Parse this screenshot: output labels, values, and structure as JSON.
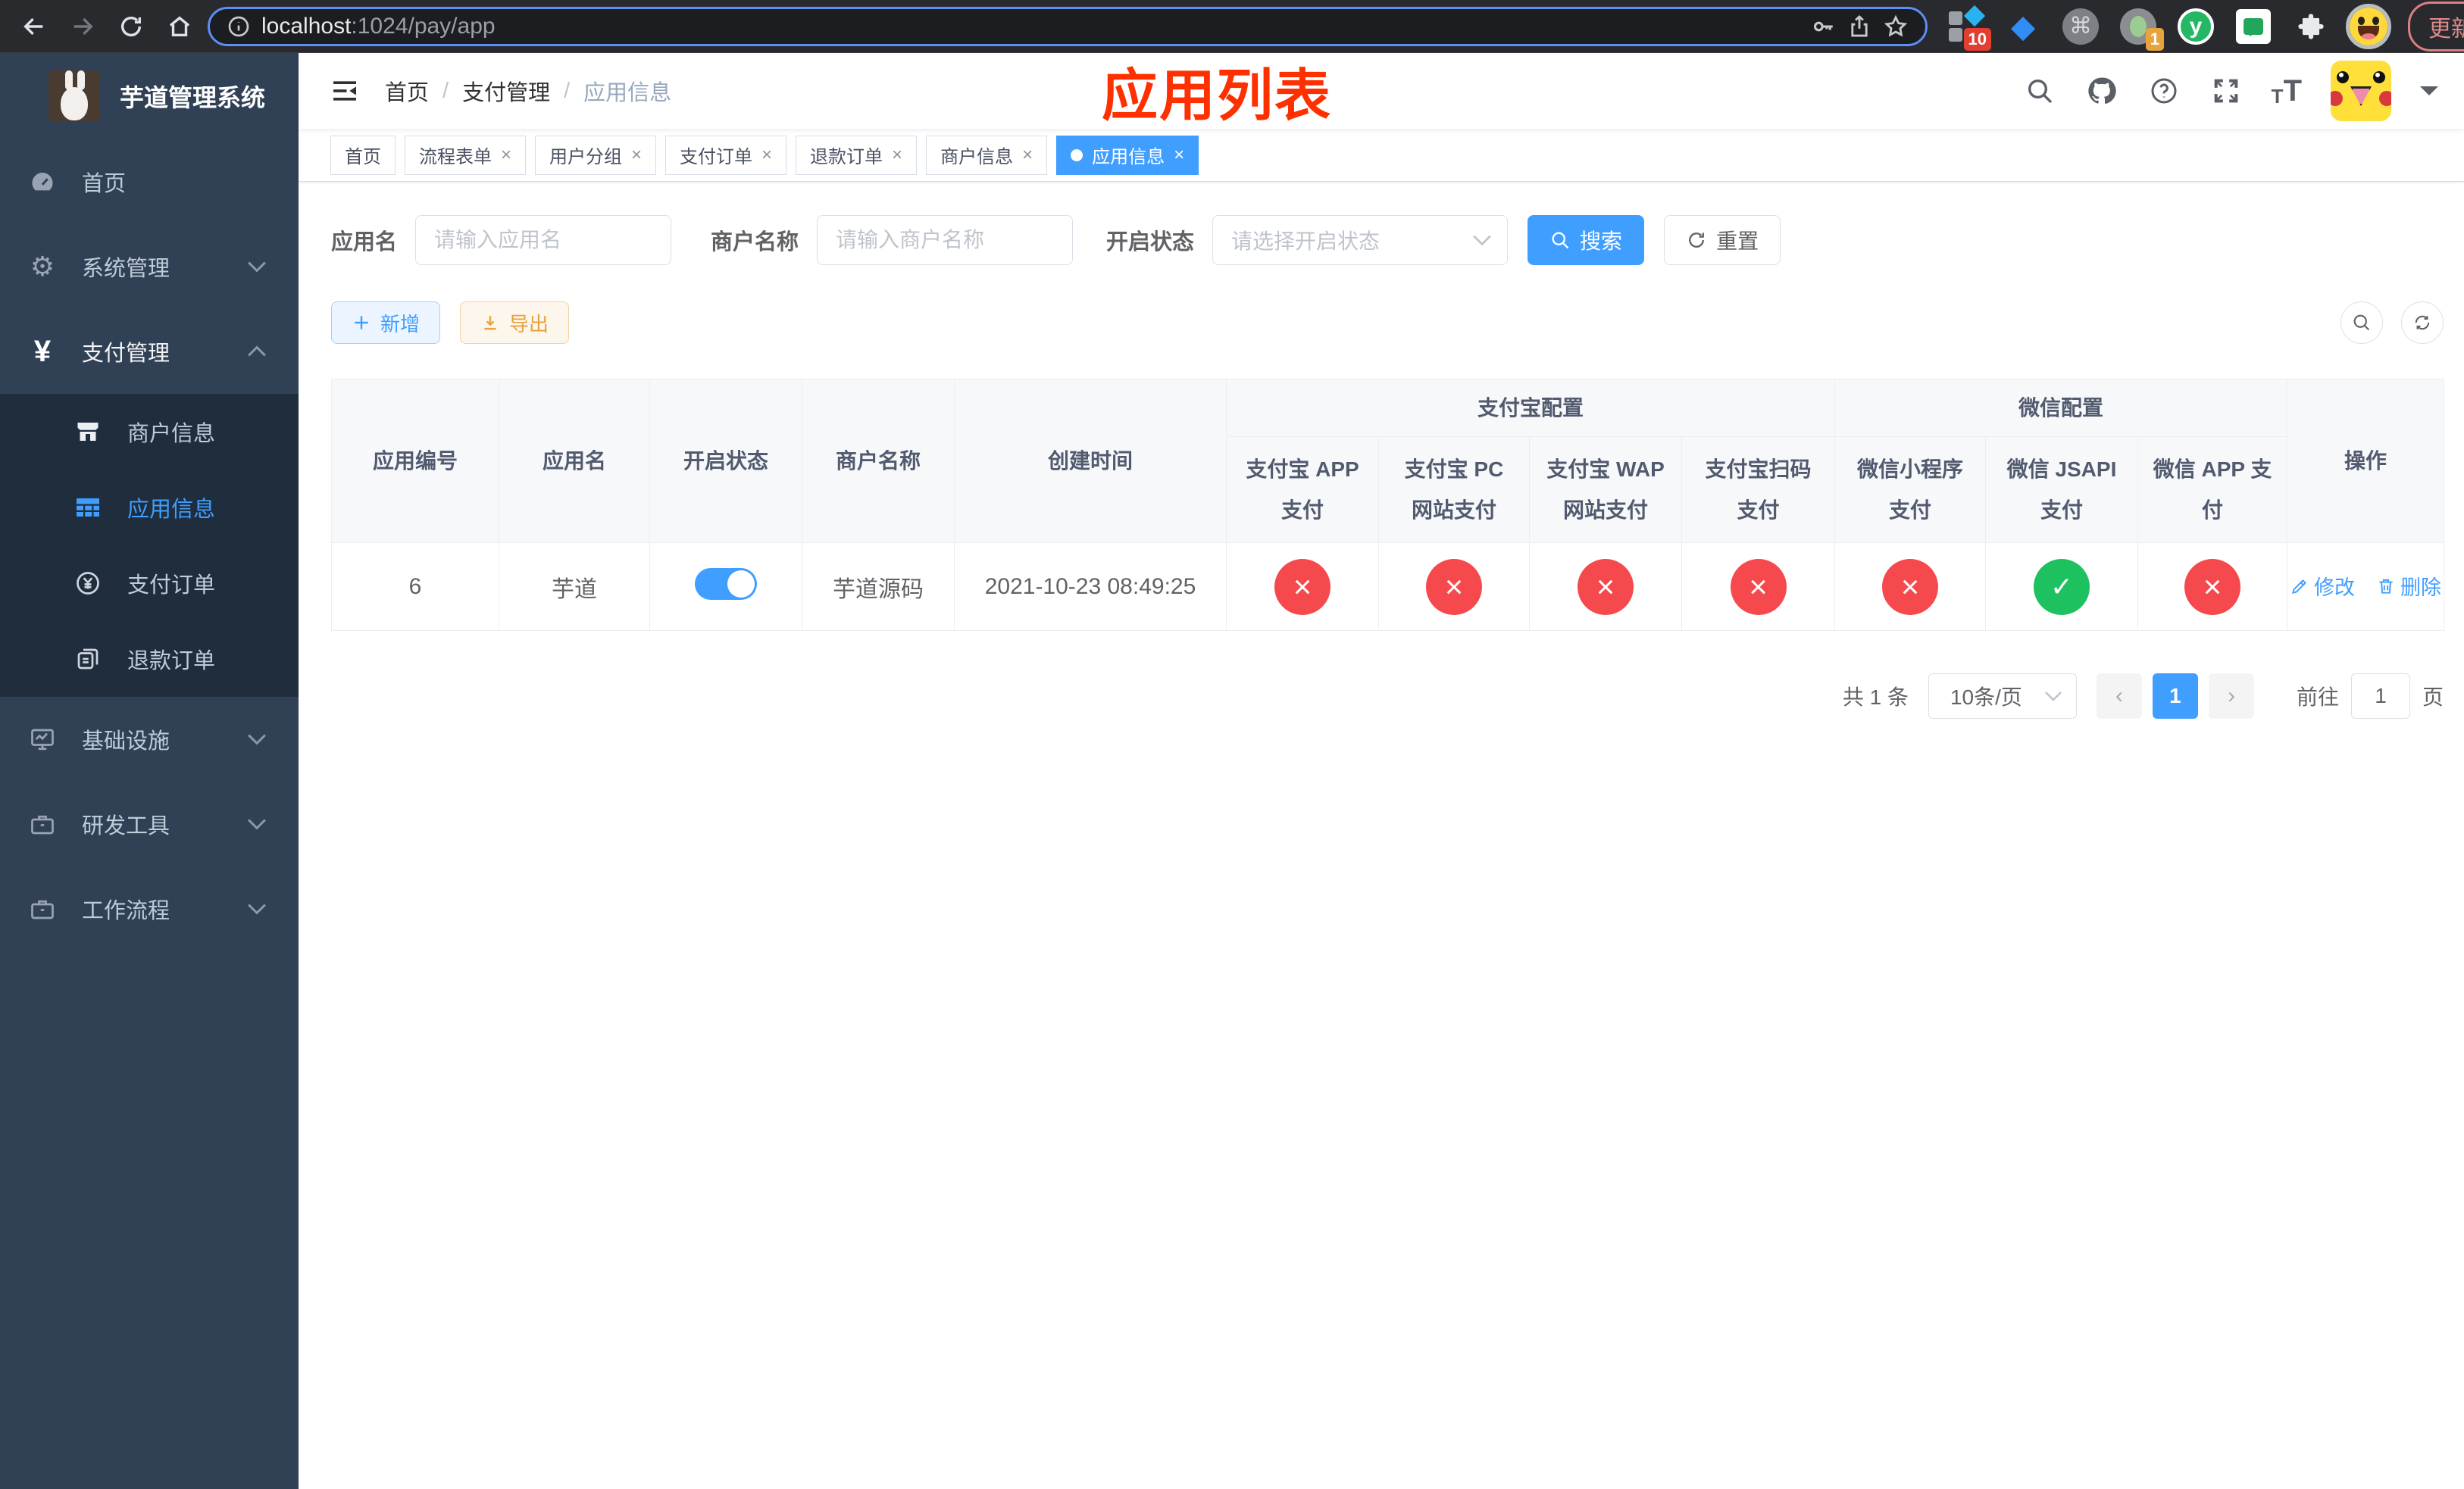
{
  "colors": {
    "accent": "#409eff",
    "banner_red": "#ff3000",
    "status_fail": "#f5494d",
    "status_ok": "#1ec15f",
    "sidebar_bg": "#304156",
    "submenu_bg": "#1f2d3d"
  },
  "browser": {
    "url_host": "localhost",
    "url_path": ":1024/pay/app",
    "ext_badge_grid": "10",
    "ext_badge_cam": "1",
    "ext_yuque_letter": "y",
    "update_label": "更新"
  },
  "sidebar": {
    "title": "芋道管理系统",
    "items": [
      {
        "label": "首页"
      },
      {
        "label": "系统管理"
      },
      {
        "label": "支付管理"
      },
      {
        "label": "商户信息"
      },
      {
        "label": "应用信息"
      },
      {
        "label": "支付订单"
      },
      {
        "label": "退款订单"
      },
      {
        "label": "基础设施"
      },
      {
        "label": "研发工具"
      },
      {
        "label": "工作流程"
      }
    ]
  },
  "navbar": {
    "breadcrumb": [
      "首页",
      "支付管理",
      "应用信息"
    ],
    "separator": "/",
    "banner": "应用列表"
  },
  "tabs": [
    {
      "label": "首页"
    },
    {
      "label": "流程表单"
    },
    {
      "label": "用户分组"
    },
    {
      "label": "支付订单"
    },
    {
      "label": "退款订单"
    },
    {
      "label": "商户信息"
    },
    {
      "label": "应用信息"
    }
  ],
  "filters": {
    "app_name_label": "应用名",
    "app_name_placeholder": "请输入应用名",
    "merchant_label": "商户名称",
    "merchant_placeholder": "请输入商户名称",
    "status_label": "开启状态",
    "status_placeholder": "请选择开启状态",
    "search_label": "搜索",
    "reset_label": "重置"
  },
  "toolbar": {
    "add_label": "新增",
    "export_label": "导出"
  },
  "table": {
    "columns": {
      "app_id": "应用编号",
      "app_name": "应用名",
      "status": "开启状态",
      "merchant": "商户名称",
      "create_time": "创建时间",
      "alipay_group": "支付宝配置",
      "wechat_group": "微信配置",
      "actions": "操作",
      "alipay_app": "支付宝 APP 支付",
      "alipay_pc": "支付宝 PC 网站支付",
      "alipay_wap": "支付宝 WAP 网站支付",
      "alipay_qr": "支付宝扫码支付",
      "wx_mini": "微信小程序支付",
      "wx_jsapi": "微信 JSAPI 支付",
      "wx_app": "微信 APP 支付"
    },
    "row": {
      "app_id": "6",
      "app_name": "芋道",
      "status": "on",
      "merchant": "芋道源码",
      "create_time": "2021-10-23 08:49:25",
      "configs": [
        "fail",
        "fail",
        "fail",
        "fail",
        "fail",
        "ok",
        "fail"
      ],
      "edit_label": "修改",
      "delete_label": "删除"
    }
  },
  "pagination": {
    "total": "共 1 条",
    "page_size": "10条/页",
    "current_page": "1",
    "goto_label": "前往",
    "goto_value": "1",
    "page_unit": "页"
  }
}
